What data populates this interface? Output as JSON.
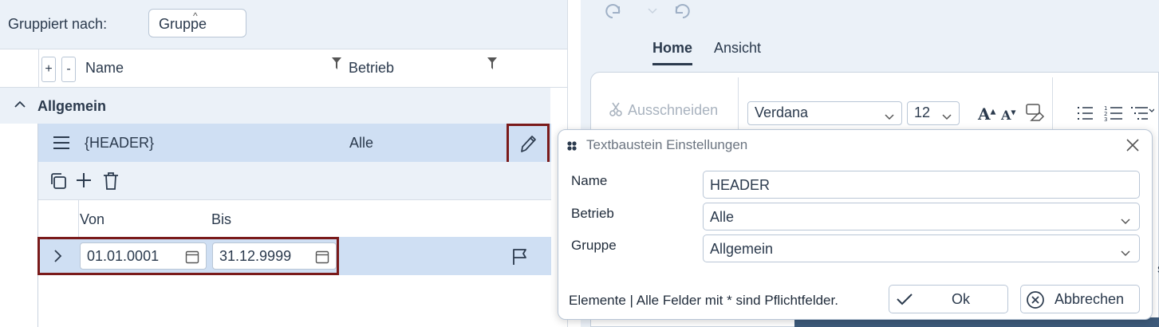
{
  "grouping": {
    "label": "Gruppiert nach:",
    "chip": "Gruppe"
  },
  "columns": {
    "name": "Name",
    "betrieb": "Betrieb",
    "expand_all": "+",
    "collapse_all": "-"
  },
  "group": {
    "name": "Allgemein"
  },
  "item": {
    "name": "{HEADER}",
    "betrieb": "Alle"
  },
  "sub_columns": {
    "von": "Von",
    "bis": "Bis"
  },
  "validity": {
    "von": "01.01.0001",
    "bis": "31.12.9999"
  },
  "ribbon": {
    "tabs": [
      "Home",
      "Ansicht"
    ],
    "cut_label": "Ausschneiden",
    "font": "Verdana",
    "font_size": "12",
    "edge_text": "s"
  },
  "dialog": {
    "title": "Textbaustein Einstellungen",
    "fields": [
      {
        "label": "Name",
        "value": "HEADER"
      },
      {
        "label": "Betrieb",
        "value": "Alle"
      },
      {
        "label": "Gruppe",
        "value": "Allgemein"
      }
    ],
    "footer": "Elemente | Alle Felder mit * sind Pflichtfelder.",
    "ok": "Ok",
    "cancel": "Abbrechen"
  },
  "colors": {
    "accent_border": "#7a1a1a",
    "row_selected": "#cfdff3",
    "panel_bg": "#ebf1f8",
    "text": "#2b3a4d"
  }
}
